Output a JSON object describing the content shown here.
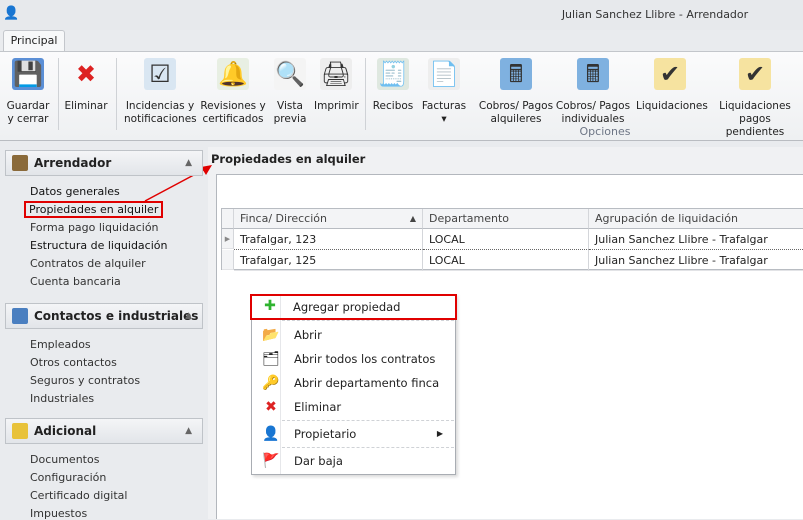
{
  "window": {
    "title": "Julian Sanchez Llibre - Arrendador"
  },
  "ribbon": {
    "tab": "Principal",
    "group_label": "Opciones",
    "buttons": [
      {
        "line1": "Guardar",
        "line2": "y cerrar",
        "icon": "save-icon"
      },
      {
        "line1": "Eliminar",
        "line2": "",
        "icon": "delete-icon"
      },
      {
        "line1": "Incidencias y",
        "line2": "notificaciones",
        "icon": "incidents-icon"
      },
      {
        "line1": "Revisiones y",
        "line2": "certificados",
        "icon": "bell-icon"
      },
      {
        "line1": "Vista",
        "line2": "previa",
        "icon": "preview-icon"
      },
      {
        "line1": "Imprimir",
        "line2": "",
        "icon": "printer-icon"
      },
      {
        "line1": "Recibos",
        "line2": "",
        "icon": "receipt-icon"
      },
      {
        "line1": "Facturas",
        "line2": "▾",
        "icon": "invoice-icon"
      },
      {
        "line1": "Cobros/ Pagos",
        "line2": "alquileres",
        "icon": "calculator-icon"
      },
      {
        "line1": "Cobros/ Pagos",
        "line2": "individuales",
        "icon": "calculator-person-icon"
      },
      {
        "line1": "Liquidaciones",
        "line2": "",
        "icon": "certificate-icon"
      },
      {
        "line1": "Liquidaciones",
        "line2": "pagos pendientes",
        "icon": "certificate-icon"
      }
    ]
  },
  "sidebar": {
    "groups": [
      {
        "title": "Arrendador",
        "items": [
          "Datos generales",
          "Propiedades en alquiler",
          "Forma pago liquidación",
          "Estructura de liquidación",
          "Contratos de alquiler",
          "Cuenta bancaria"
        ]
      },
      {
        "title": "Contactos e industriales",
        "items": [
          "Empleados",
          "Otros contactos",
          "Seguros y contratos",
          "Industriales"
        ]
      },
      {
        "title": "Adicional",
        "items": [
          "Documentos",
          "Configuración",
          "Certificado digital",
          "Impuestos"
        ]
      }
    ]
  },
  "main": {
    "title": "Propiedades en alquiler",
    "columns": [
      "Finca/ Dirección",
      "Departamento",
      "Agrupación de liquidación"
    ],
    "rows": [
      [
        "Trafalgar, 123",
        "LOCAL",
        "Julian Sanchez Llibre - Trafalgar"
      ],
      [
        "Trafalgar, 125",
        "LOCAL",
        "Julian Sanchez Llibre - Trafalgar"
      ]
    ]
  },
  "context_menu": {
    "items": [
      "Agregar propiedad",
      "Abrir",
      "Abrir todos los contratos",
      "Abrir departamento finca",
      "Eliminar",
      "Propietario",
      "Dar baja"
    ]
  },
  "colors": {
    "highlight": "#e00000"
  }
}
